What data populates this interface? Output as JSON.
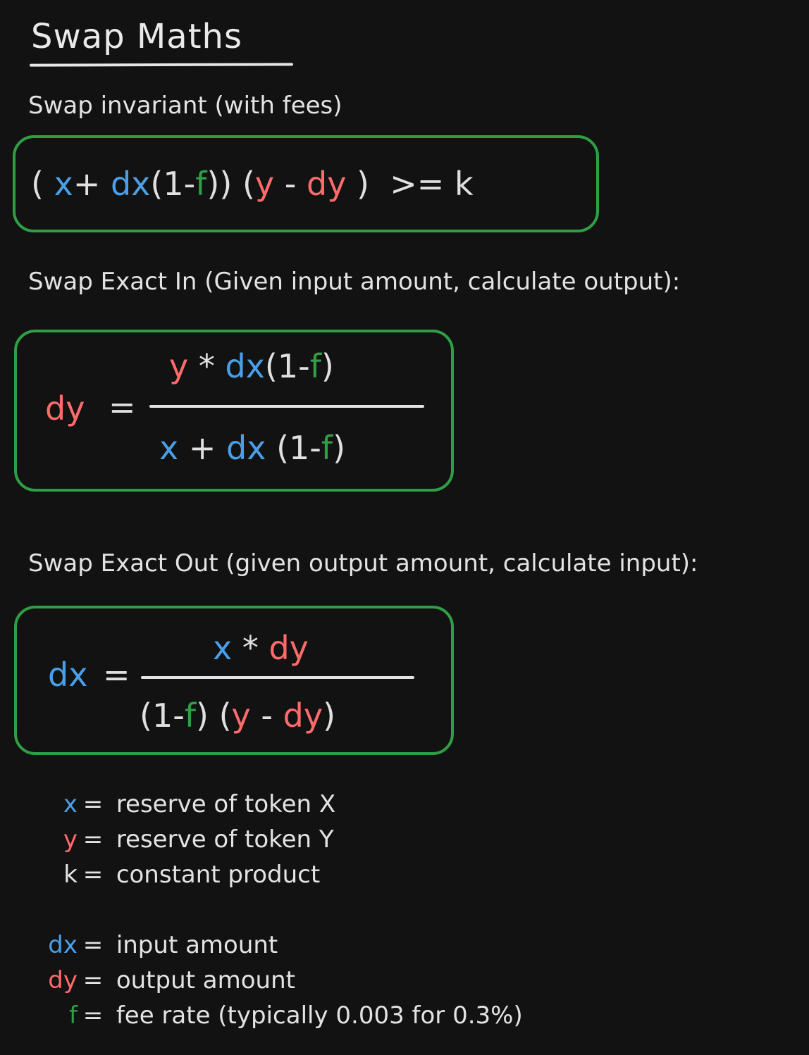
{
  "title": "Swap Maths",
  "sections": {
    "invariant": {
      "label": "Swap invariant (with fees)",
      "expr": {
        "p1": "(",
        "x": "x",
        "plus": "+",
        "dx": "dx",
        "p2": "(1-",
        "f": "f",
        "p3": "))",
        "p4": "(",
        "y": "y",
        "minus": "-",
        "dy": "dy",
        "p5": ")",
        "ge": ">=",
        "k": "k"
      }
    },
    "exact_in": {
      "label": "Swap Exact In (Given input amount, calculate output):",
      "lhs": "dy",
      "eq": "=",
      "numerator": {
        "y": "y",
        "times": "*",
        "dx": "dx",
        "p1": "(1-",
        "f": "f",
        "p2": ")"
      },
      "denominator": {
        "x": "x",
        "plus": "+",
        "dx": "dx",
        "p1": "(1-",
        "f": "f",
        "p2": ")"
      }
    },
    "exact_out": {
      "label": "Swap Exact Out (given output amount, calculate input):",
      "lhs": "dx",
      "eq": "=",
      "numerator": {
        "x": "x",
        "times": "*",
        "dy": "dy"
      },
      "denominator": {
        "p1": "(1-",
        "f": "f",
        "p2": ")",
        "p3": "(",
        "y": "y",
        "minus": "-",
        "dy": "dy",
        "p4": ")"
      }
    }
  },
  "legend": {
    "group1": [
      {
        "symbol": "x",
        "eq": "=",
        "text": "reserve of token X"
      },
      {
        "symbol": "y",
        "eq": "=",
        "text": "reserve of token Y"
      },
      {
        "symbol": "k",
        "eq": "=",
        "text": "constant product"
      }
    ],
    "group2": [
      {
        "symbol": "dx",
        "eq": "=",
        "text": "input amount"
      },
      {
        "symbol": "dy",
        "eq": "=",
        "text": "output amount"
      },
      {
        "symbol": "f",
        "eq": "=",
        "text": "fee rate (typically 0.003 for 0.3%)"
      }
    ]
  },
  "colors": {
    "background": "#121212",
    "x_dx": "#4a9fe8",
    "y_dy": "#ff6b6b",
    "fee": "#2f9e44",
    "box_border": "#2f9e44",
    "text": "#e3e3e3"
  }
}
